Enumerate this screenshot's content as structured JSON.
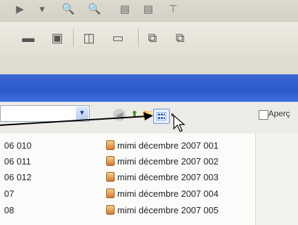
{
  "toolbar": {
    "top_icons": [
      "arrow-right-icon",
      "zoom-in-icon",
      "zoom-out-icon",
      "print-icon",
      "print-preview-icon",
      "monitor-icon"
    ],
    "main_icons": [
      "monitor-icon",
      "image-icon",
      "book-icon",
      "page-icon",
      "copy-icon",
      "paste-icon"
    ]
  },
  "nav": {
    "view_menu_icon": "thumbnails-icon",
    "preview_label": "Aperç"
  },
  "files": {
    "left_column": [
      "06 010",
      "06 011",
      "06 012",
      "07",
      "08"
    ],
    "right_column": [
      "mimi décembre 2007 001",
      "mimi décembre 2007 002",
      "mimi décembre 2007 003",
      "mimi décembre 2007 004",
      "mimi décembre 2007 005"
    ]
  },
  "colors": {
    "title_bar": "#2c57c8",
    "arrow": "#000000"
  }
}
